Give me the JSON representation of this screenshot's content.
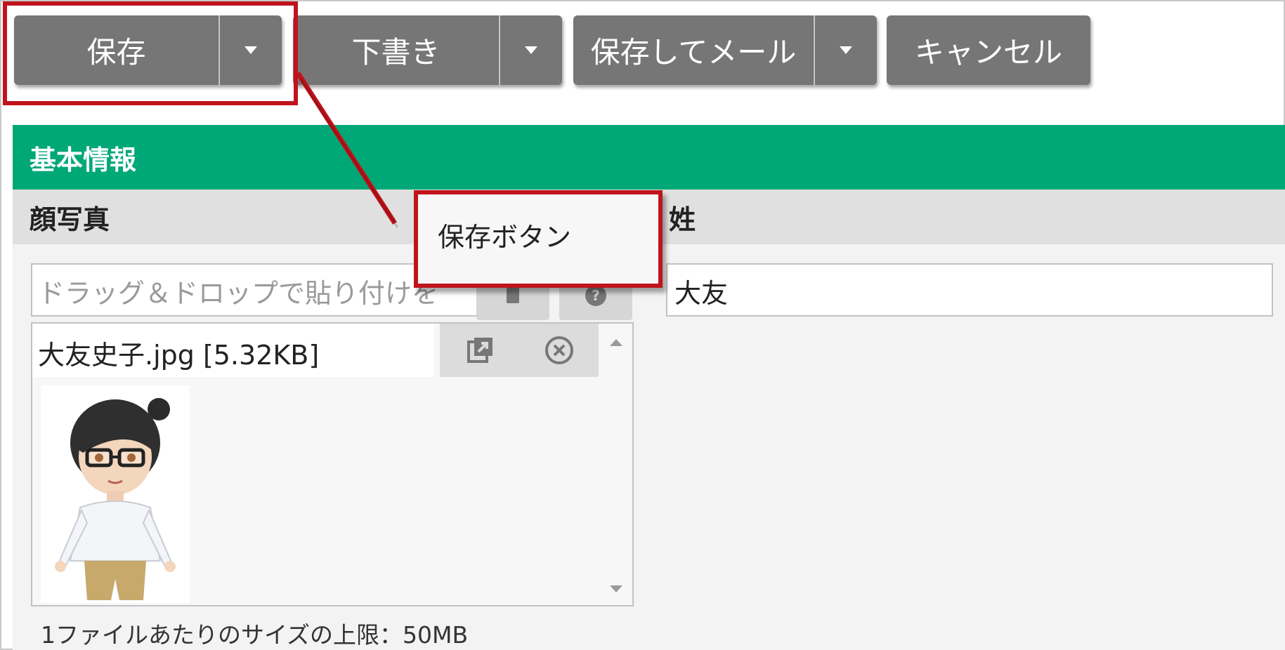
{
  "toolbar": {
    "save_label": "保存",
    "draft_label": "下書き",
    "save_mail_label": "保存してメール",
    "cancel_label": "キャンセル"
  },
  "section": {
    "title": "基本情報",
    "photo_label": "顔写真",
    "surname_label": "姓"
  },
  "photo": {
    "dropzone_placeholder": "ドラッグ＆ドロップで貼り付けを",
    "file_name": "大友史子.jpg [5.32KB]",
    "size_limit_note": "1ファイルあたりのサイズの上限：50MB"
  },
  "surname": {
    "value": "大友"
  },
  "callout": {
    "text": "保存ボタン"
  },
  "colors": {
    "button_gray": "#767676",
    "section_green": "#00a877",
    "highlight_red": "#c0141c"
  }
}
